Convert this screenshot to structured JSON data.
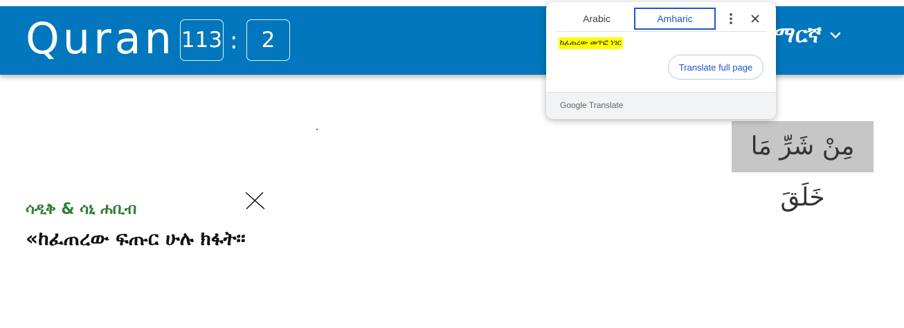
{
  "header": {
    "brand": "Quran",
    "surah_number": "113",
    "separator": ":",
    "ayah_number": "2",
    "language_label": "ማርኛ",
    "background_color": "#0277bd"
  },
  "verse": {
    "arabic_text": "مِنْ شَرِّ مَا خَلَقَ",
    "translator": "ሳዲቅ & ሳኒ ሐቢብ",
    "translation": "«ከፈጠረው ፍጡር ሁሉ ክፋት፡፡"
  },
  "google_translate": {
    "tabs": [
      {
        "label": "Arabic",
        "active": false
      },
      {
        "label": "Amharic",
        "active": true
      }
    ],
    "translated_text": "ከፈጠረው መጥፎ ነገር",
    "translate_full_page_label": "Translate full page",
    "footer_brand": "Google Translate",
    "accent_color": "#1a56c9",
    "menu_icon": "more-vert-icon",
    "close_icon": "close-icon"
  }
}
